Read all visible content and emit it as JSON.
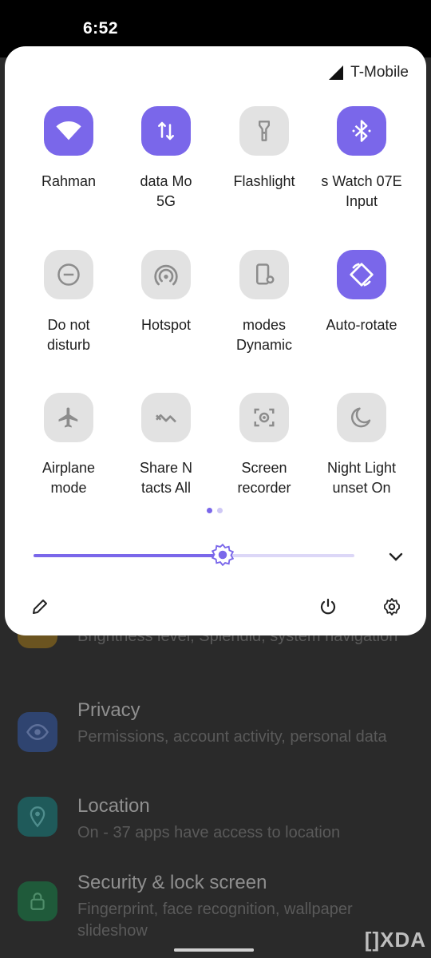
{
  "status_bar": {
    "time": "6:52"
  },
  "carrier": "T-Mobile",
  "tiles": [
    {
      "name": "wifi",
      "lines": [
        "Rahman"
      ],
      "state": "on",
      "icon": "wifi-icon"
    },
    {
      "name": "mobile-data",
      "lines": [
        "data    Mo",
        "5G"
      ],
      "state": "on",
      "icon": "mobile-data-icon"
    },
    {
      "name": "flashlight",
      "lines": [
        "Flashlight"
      ],
      "state": "off",
      "icon": "flashlight-icon"
    },
    {
      "name": "bluetooth",
      "lines": [
        "s Watch 07E",
        "Input"
      ],
      "state": "on",
      "icon": "bluetooth-icon"
    },
    {
      "name": "do-not-disturb",
      "lines": [
        "Do not",
        "disturb"
      ],
      "state": "off",
      "icon": "do-not-disturb-icon"
    },
    {
      "name": "hotspot",
      "lines": [
        "Hotspot"
      ],
      "state": "off",
      "icon": "hotspot-icon"
    },
    {
      "name": "dynamic-modes",
      "lines": [
        "modes",
        "Dynamic"
      ],
      "state": "off",
      "icon": "dynamic-modes-icon"
    },
    {
      "name": "auto-rotate",
      "lines": [
        "Auto-rotate"
      ],
      "state": "on",
      "icon": "auto-rotate-icon"
    },
    {
      "name": "airplane-mode",
      "lines": [
        "Airplane",
        "mode"
      ],
      "state": "off",
      "icon": "airplane-icon"
    },
    {
      "name": "nearby-share",
      "lines": [
        "Share      N",
        "tacts    All"
      ],
      "state": "off",
      "icon": "nearby-share-icon"
    },
    {
      "name": "screen-recorder",
      "lines": [
        "Screen",
        "recorder"
      ],
      "state": "off",
      "icon": "screen-recorder-icon"
    },
    {
      "name": "night-light",
      "lines": [
        "Night Light",
        "unset    On"
      ],
      "state": "off",
      "icon": "night-light-icon"
    }
  ],
  "brightness": {
    "level": 0.59
  },
  "colors": {
    "accent": "#7a67ea",
    "tile_off": "#e2e2e2",
    "icon_off": "#8c8c8c"
  },
  "background_settings": [
    {
      "title": "",
      "subtitle": "Brightness level, Splendid, system navigation",
      "icon": "display-icon",
      "color": "#6b5420"
    },
    {
      "title": "Privacy",
      "subtitle": "Permissions, account activity, personal data",
      "icon": "privacy-icon",
      "color": "#2f4470"
    },
    {
      "title": "Location",
      "subtitle": "On - 37 apps have access to location",
      "icon": "location-icon",
      "color": "#1f5a5a"
    },
    {
      "title": "Security & lock screen",
      "subtitle": "Fingerprint, face recognition, wallpaper slideshow",
      "icon": "lock-icon",
      "color": "#1f5a3a"
    }
  ],
  "watermark": "[]XDA"
}
